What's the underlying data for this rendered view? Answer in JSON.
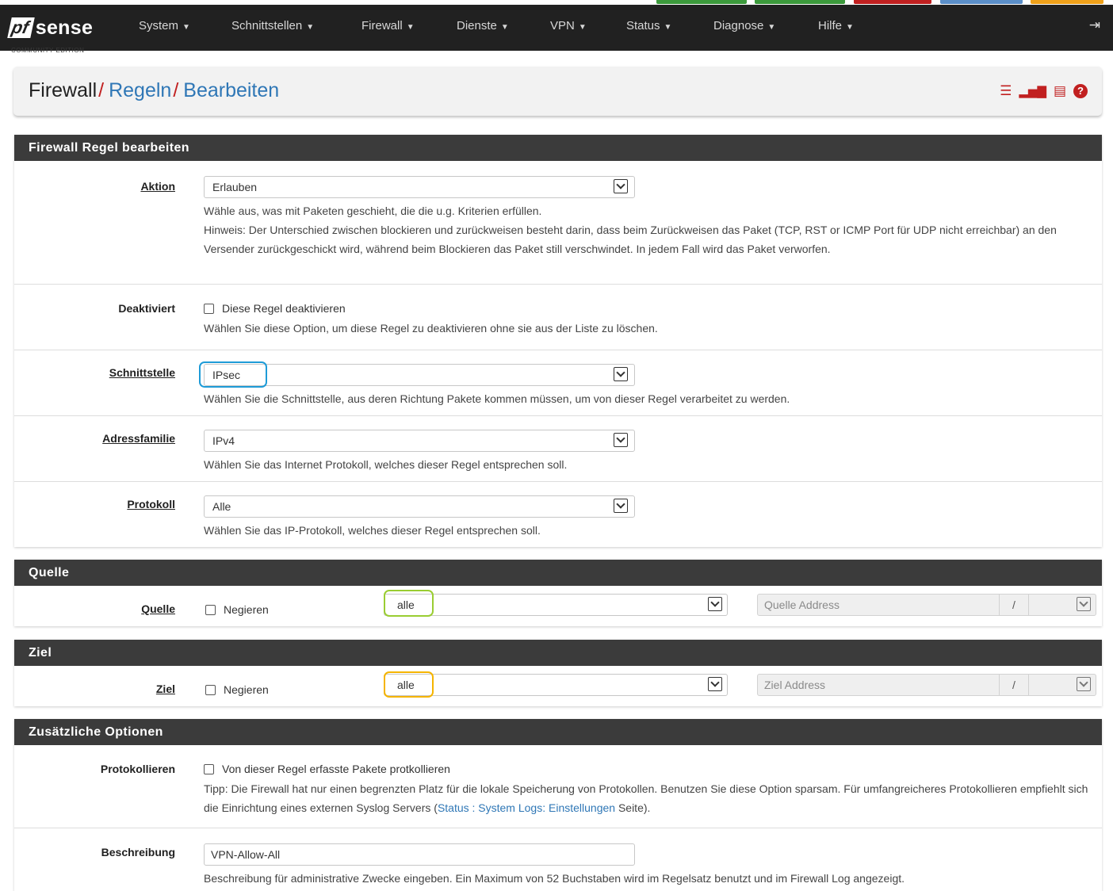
{
  "colors": {
    "navbar": "#212121",
    "accent_red": "#c12020",
    "link_blue": "#2f77b6",
    "panel_heading": "#3b3b3b",
    "highlight_interface": "#1e9bd7",
    "highlight_source": "#9acd32",
    "highlight_destination": "#f5b400"
  },
  "brand": {
    "logo_pf": "pf",
    "logo_sense": "sense",
    "edition": "COMMUNITY EDITION"
  },
  "nav": {
    "items": [
      {
        "label": "System",
        "icon": "caret-down-icon"
      },
      {
        "label": "Schnittstellen",
        "icon": "caret-down-icon"
      },
      {
        "label": "Firewall",
        "icon": "caret-down-icon"
      },
      {
        "label": "Dienste",
        "icon": "caret-down-icon"
      },
      {
        "label": "VPN",
        "icon": "caret-down-icon"
      },
      {
        "label": "Status",
        "icon": "caret-down-icon"
      },
      {
        "label": "Diagnose",
        "icon": "caret-down-icon"
      },
      {
        "label": "Hilfe",
        "icon": "caret-down-icon"
      }
    ],
    "logout_icon": "sign-out-icon"
  },
  "breadcrumb": {
    "root": "Firewall",
    "sep": "/",
    "level1": "Regeln",
    "level2": "Bearbeiten",
    "icons": [
      "sliders-icon",
      "bar-chart-icon",
      "list-table-icon",
      "help-circle-icon"
    ],
    "help_glyph": "?"
  },
  "rule_panel": {
    "heading": "Firewall Regel bearbeiten",
    "action": {
      "label": "Aktion",
      "value": "Erlauben",
      "help1": "Wähle aus, was mit Paketen geschieht, die die u.g. Kriterien erfüllen.",
      "help2": "Hinweis: Der Unterschied zwischen blockieren und zurückweisen besteht darin, dass beim Zurückweisen das Paket (TCP, RST or ICMP Port für UDP nicht erreichbar) an den Versender zurückgeschickt wird, während beim Blockieren das Paket still verschwindet. In jedem Fall wird das Paket verworfen."
    },
    "disabled": {
      "label": "Deaktiviert",
      "checkbox_label": "Diese Regel deaktivieren",
      "help": "Wählen Sie diese Option, um diese Regel zu deaktivieren ohne sie aus der Liste zu löschen."
    },
    "interface": {
      "label": "Schnittstelle",
      "value": "IPsec",
      "help": "Wählen Sie die Schnittstelle, aus deren Richtung Pakete kommen müssen, um von dieser Regel verarbeitet zu werden."
    },
    "address_family": {
      "label": "Adressfamilie",
      "value": "IPv4",
      "help": "Wählen Sie das Internet Protokoll, welches dieser Regel entsprechen soll."
    },
    "protocol": {
      "label": "Protokoll",
      "value": "Alle",
      "help": "Wählen Sie das IP-Protokoll, welches dieser Regel entsprechen soll."
    }
  },
  "source_panel": {
    "heading": "Quelle",
    "label": "Quelle",
    "negate_label": "Negieren",
    "type_value": "alle",
    "address_placeholder": "Quelle Address",
    "slash": "/"
  },
  "destination_panel": {
    "heading": "Ziel",
    "label": "Ziel",
    "negate_label": "Negieren",
    "type_value": "alle",
    "address_placeholder": "Ziel Address",
    "slash": "/"
  },
  "extra_panel": {
    "heading": "Zusätzliche Optionen",
    "log": {
      "label": "Protokollieren",
      "checkbox_label": "Von dieser Regel erfasste Pakete protkollieren",
      "help_before": "Tipp: Die Firewall hat nur einen begrenzten Platz für die lokale Speicherung von Protokollen. Benutzen Sie diese Option sparsam. Für umfangreicheres Protokollieren empfiehlt sich die Einrichtung eines externen Syslog Servers (",
      "help_link": "Status : System Logs: Einstellungen",
      "help_after": " Seite)."
    },
    "description": {
      "label": "Beschreibung",
      "value": "VPN-Allow-All",
      "help": "Beschreibung für administrative Zwecke eingeben. Ein Maximum von 52 Buchstaben wird im Regelsatz benutzt und im Firewall Log angezeigt."
    }
  }
}
